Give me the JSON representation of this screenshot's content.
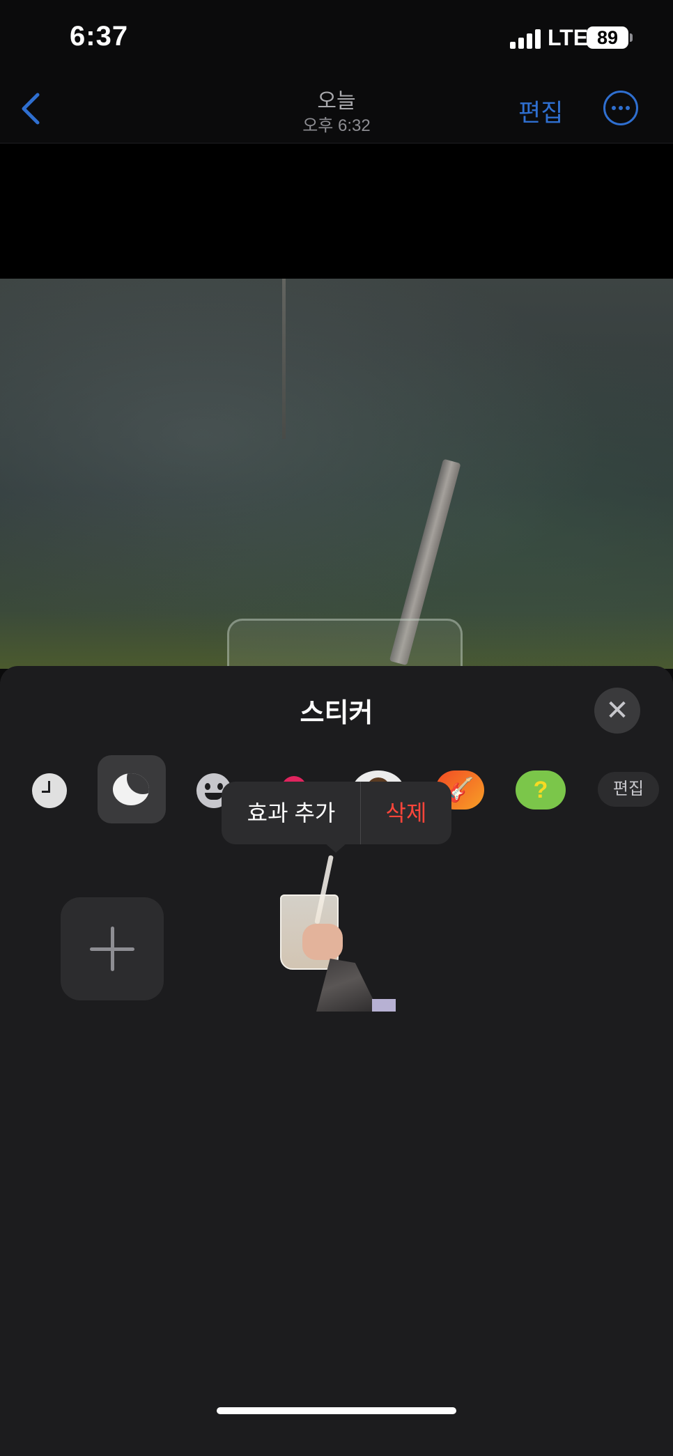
{
  "status_bar": {
    "time": "6:37",
    "network": "LTE",
    "battery": "89"
  },
  "nav": {
    "title": "오늘",
    "subtitle": "오후 6:32",
    "edit_label": "편집",
    "accent_color": "#2f6fd0"
  },
  "sticker_sheet": {
    "title": "스티커",
    "tabs": [
      "recent-icon",
      "stickers-icon",
      "emoji-icon",
      "memoji-icon",
      "animoji-icon",
      "garageband-icon",
      "game-icon"
    ],
    "selected_tab": "stickers",
    "edit_tab_label": "편집",
    "context_menu": {
      "add_effect_label": "효과 추가",
      "delete_label": "삭제",
      "delete_color": "#ff453a"
    }
  }
}
